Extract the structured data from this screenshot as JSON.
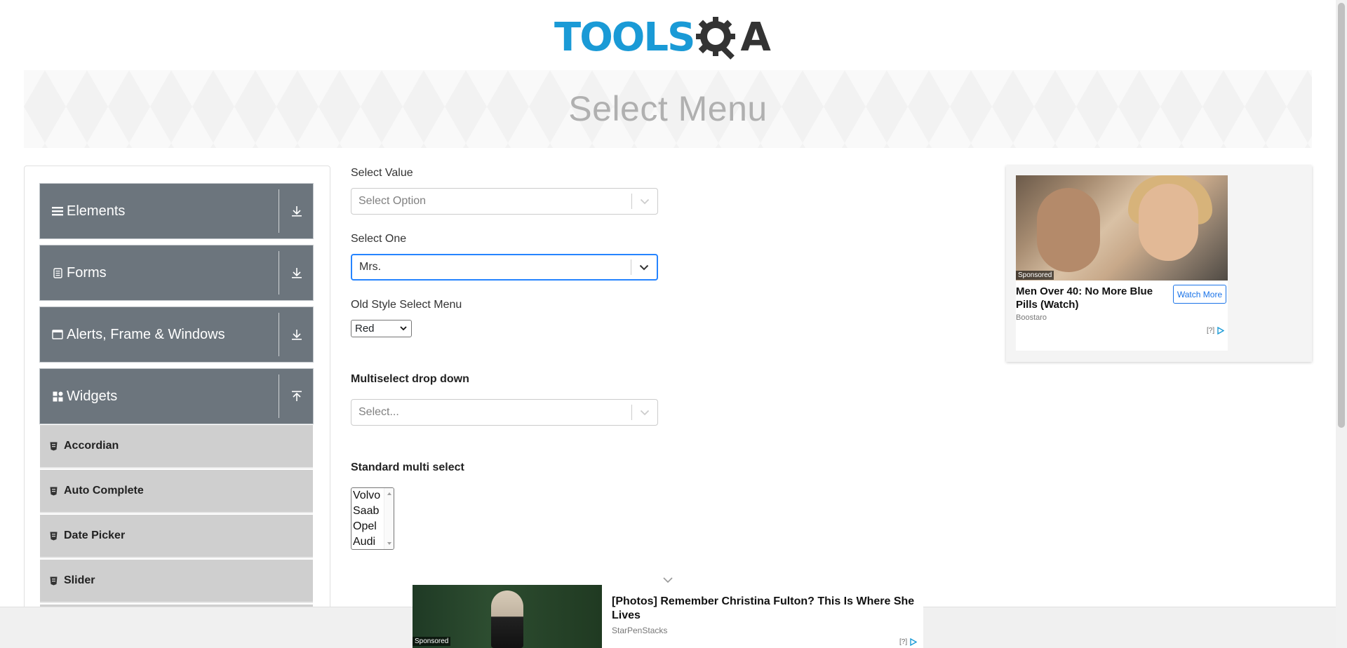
{
  "logo": {
    "part1": "TOOLS",
    "part2": "A",
    "alt": "TOOLSQA"
  },
  "banner": {
    "title": "Select Menu"
  },
  "sidebar": {
    "groups": [
      {
        "label": "Elements",
        "icon": "hamburger-icon",
        "state": "collapsed"
      },
      {
        "label": "Forms",
        "icon": "form-icon",
        "state": "collapsed"
      },
      {
        "label": "Alerts, Frame & Windows",
        "icon": "window-icon",
        "state": "collapsed"
      },
      {
        "label": "Widgets",
        "icon": "widgets-icon",
        "state": "expanded"
      }
    ],
    "widget_items": [
      {
        "label": "Accordian"
      },
      {
        "label": "Auto Complete"
      },
      {
        "label": "Date Picker"
      },
      {
        "label": "Slider"
      }
    ]
  },
  "form": {
    "select_value": {
      "label": "Select Value",
      "placeholder": "Select Option"
    },
    "select_one": {
      "label": "Select One",
      "value": "Mrs."
    },
    "old_style": {
      "label": "Old Style Select Menu",
      "value": "Red"
    },
    "multiselect": {
      "label": "Multiselect drop down",
      "placeholder": "Select..."
    },
    "standard_multi": {
      "label": "Standard multi select",
      "options": [
        "Volvo",
        "Saab",
        "Opel",
        "Audi"
      ]
    }
  },
  "ad_right": {
    "sponsored": "Sponsored",
    "headline": "Men Over 40: No More Blue Pills (Watch)",
    "source": "Boostaro",
    "button": "Watch More",
    "info": "[?]"
  },
  "ad_bottom": {
    "sponsored": "Sponsored",
    "headline": "[Photos] Remember Christina Fulton? This Is Where She Lives",
    "source": "StarPenStacks",
    "info": "[?]"
  },
  "colors": {
    "accent": "#1a9ad6",
    "sidebar_group": "#6c757d",
    "sidebar_item": "#cfcfcf",
    "focus": "#2684ff"
  }
}
